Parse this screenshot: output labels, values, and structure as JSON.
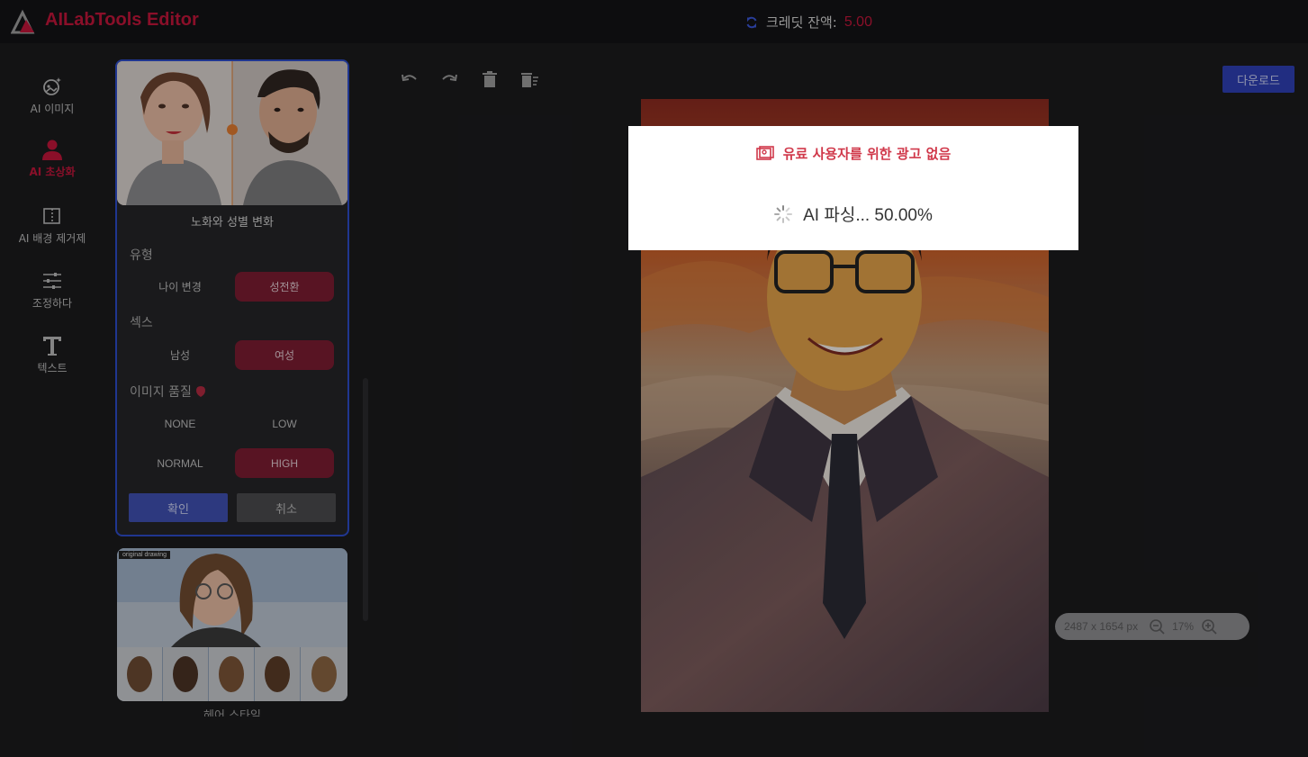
{
  "header": {
    "app_title": "AILabTools Editor",
    "credits_label": "크레딧 잔액:",
    "credits_value": "5.00",
    "brand_color": "#c0163a"
  },
  "nav": {
    "items": [
      {
        "label": "AI 이미지",
        "icon": "ai-image-icon"
      },
      {
        "label": "AI 초상화",
        "icon": "portrait-icon",
        "active": true
      },
      {
        "label": "AI 배경 제거제",
        "icon": "background-remove-icon"
      },
      {
        "label": "조정하다",
        "icon": "sliders-icon"
      },
      {
        "label": "텍스트",
        "icon": "text-icon"
      }
    ]
  },
  "panel": {
    "card_title": "노화와 성별 변화",
    "type_label": "유형",
    "type_options": [
      "나이 변경",
      "성전환"
    ],
    "type_selected": "성전환",
    "sex_label": "섹스",
    "sex_options": [
      "남성",
      "여성"
    ],
    "sex_selected": "여성",
    "quality_label": "이미지 품질",
    "quality_options": [
      "NONE",
      "LOW",
      "NORMAL",
      "HIGH"
    ],
    "quality_selected": "HIGH",
    "confirm_label": "확인",
    "cancel_label": "취소",
    "card2_tag": "original drawing",
    "card2_title": "헤어 스타일"
  },
  "toolbar": {
    "download_label": "다운로드",
    "icons": [
      "undo-icon",
      "redo-icon",
      "delete-icon",
      "clear-all-icon"
    ]
  },
  "zoom": {
    "dimensions": "2487 x 1654 px",
    "level": "17%"
  },
  "modal": {
    "ad_text": "유료 사용자를 위한 광고 없음",
    "progress_text": "AI 파싱... 50.00%",
    "progress": 0.5
  }
}
